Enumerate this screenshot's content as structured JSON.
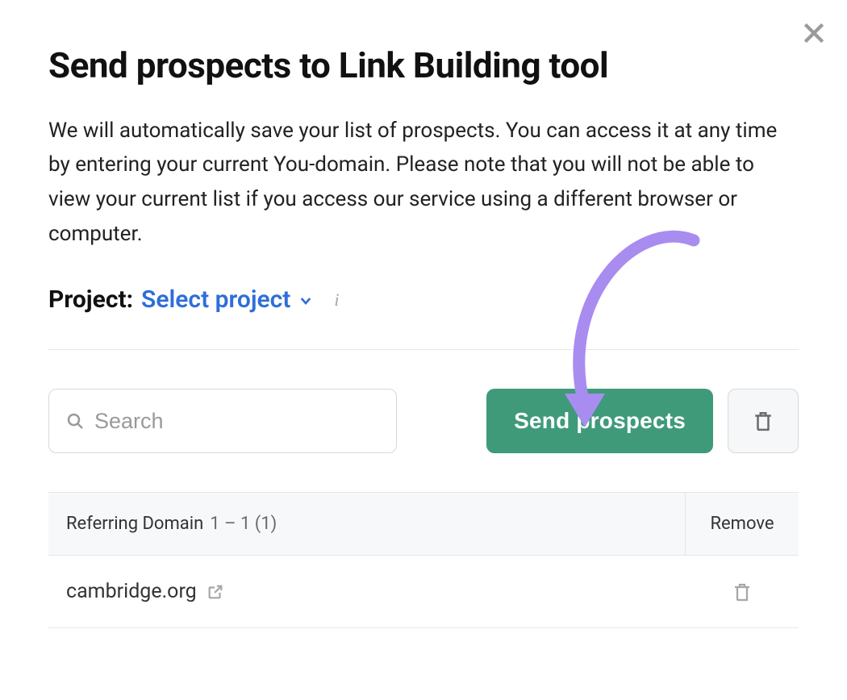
{
  "modal": {
    "title": "Send prospects to Link Building tool",
    "description": "We will automatically save your list of prospects. You can access it at any time by entering your current You-domain. Please note that you will not be able to view your current list if you access our service using a different browser or computer."
  },
  "project": {
    "label": "Project:",
    "select_label": "Select project",
    "info_glyph": "i"
  },
  "search": {
    "placeholder": "Search"
  },
  "actions": {
    "send_label": "Send prospects"
  },
  "table": {
    "col_domain_label": "Referring Domain",
    "col_domain_range": "1 – 1 (1)",
    "col_remove_label": "Remove",
    "rows": [
      {
        "domain": "cambridge.org"
      }
    ]
  },
  "colors": {
    "accent_green": "#3f9a7a",
    "link_blue": "#2e6ed9",
    "annotation_purple": "#a88cf0"
  }
}
